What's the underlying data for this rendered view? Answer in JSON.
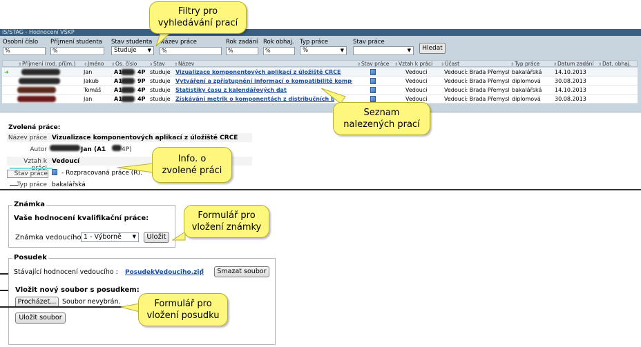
{
  "app": {
    "title": "IS/STAG - Hodnocení VŠKP"
  },
  "filters": {
    "osobni_cislo": {
      "label": "Osobní číslo",
      "value": "%"
    },
    "prijmeni": {
      "label": "Příjmení studenta",
      "value": "%"
    },
    "stav_studenta": {
      "label": "Stav studenta",
      "value": "Studuje"
    },
    "nazev_prace": {
      "label": "Název práce",
      "value": "%"
    },
    "rok_zadani": {
      "label": "Rok zadání",
      "value": "%"
    },
    "rok_obhaj": {
      "label": "Rok obhaj.",
      "value": "%"
    },
    "typ_prace": {
      "label": "Typ práce",
      "value": "%"
    },
    "stav_prace": {
      "label": "Stav práce",
      "value": ""
    },
    "search_button": "Hledat"
  },
  "grid": {
    "headers": [
      "Příjmení (rod. příjm.)",
      "Jméno",
      "Os. číslo",
      "Stav",
      "Název",
      "Stav práce",
      "Vztah k práci",
      "Účast",
      "Typ práce",
      "Datum zadání",
      "Dat. obhaj."
    ],
    "rows": [
      {
        "jmeno": "Jan",
        "os_suffix": "A1",
        "os_end": "4P",
        "stav": "studuje",
        "nazev": "Vizualizace komponentových aplikací z úložiště CRCE",
        "vztah": "Vedoucí",
        "ucast": "Vedoucí: Brada Přemysl",
        "typ": "bakalářská",
        "datum": "14.10.2013"
      },
      {
        "jmeno": "Jakub",
        "os_suffix": "A1",
        "os_end": "9P",
        "stav": "studuje",
        "nazev": "Vytváření a zpřístupnění informací o kompatibilitě komponent",
        "vztah": "Vedoucí",
        "ucast": "Vedoucí: Brada Přemysl",
        "typ": "diplomová",
        "datum": "30.08.2013"
      },
      {
        "jmeno": "Tomáš",
        "os_suffix": "A1",
        "os_end": "4P",
        "stav": "studuje",
        "nazev": "Statistiky času z kalendářových dat",
        "vztah": "Vedoucí",
        "ucast": "Vedoucí: Brada Přemysl",
        "typ": "bakalářská",
        "datum": "14.10.2013"
      },
      {
        "jmeno": "Jan",
        "os_suffix": "A1",
        "os_end": "4P",
        "stav": "studuje",
        "nazev": "Získávání metrik o komponentách z distribučních balíků",
        "vztah": "Vedoucí",
        "ucast": "Vedoucí: Brada Přemysl",
        "typ": "diplomová",
        "datum": "30.08.2013"
      }
    ]
  },
  "selected": {
    "heading": "Zvolená práce:",
    "nazev_label": "Název práce",
    "nazev_value": "Vizualizace komponentových aplikací z úložiště CRCE",
    "autor_label": "Autor",
    "autor_value": "Jan (A1",
    "autor_end": "4P)",
    "vztah_label": "Vztah k práci",
    "vztah_value": "Vedoucí",
    "stav_label": "Stav práce",
    "stav_value": "- Rozpracovaná práce (R).",
    "typ_label": "Typ práce",
    "typ_value": "bakalářská"
  },
  "znamka": {
    "legend": "Známka",
    "subheading": "Vaše hodnocení kvalifikační práce:",
    "field_label": "Známka vedoucího",
    "select_value": "1 - Výborně",
    "save_button": "Uložit"
  },
  "posudek": {
    "legend": "Posudek",
    "existing_label": "Stávající hodnocení vedoucího :",
    "file_link": "PosudekVedouciho.zip",
    "delete_button": "Smazat soubor",
    "upload_heading": "Vložit nový soubor s posudkem:",
    "browse_button": "Procházet...",
    "no_file": "Soubor nevybrán.",
    "upload_button": "Uložit soubor"
  },
  "callouts": {
    "filters": "Filtry pro\nvyhledávání prací",
    "list": "Seznam\nnalezených prací",
    "info": "Info. o\nzvolené práci",
    "grade_form": "Formulář pro\nvložení známky",
    "review_form": "Formulář pro\nvložení posudku"
  },
  "colors": {
    "callout_fill": "#fdf77e",
    "panel": "#c9d5de",
    "title_bar": "#3b5f80",
    "link": "#1a4fa0"
  }
}
